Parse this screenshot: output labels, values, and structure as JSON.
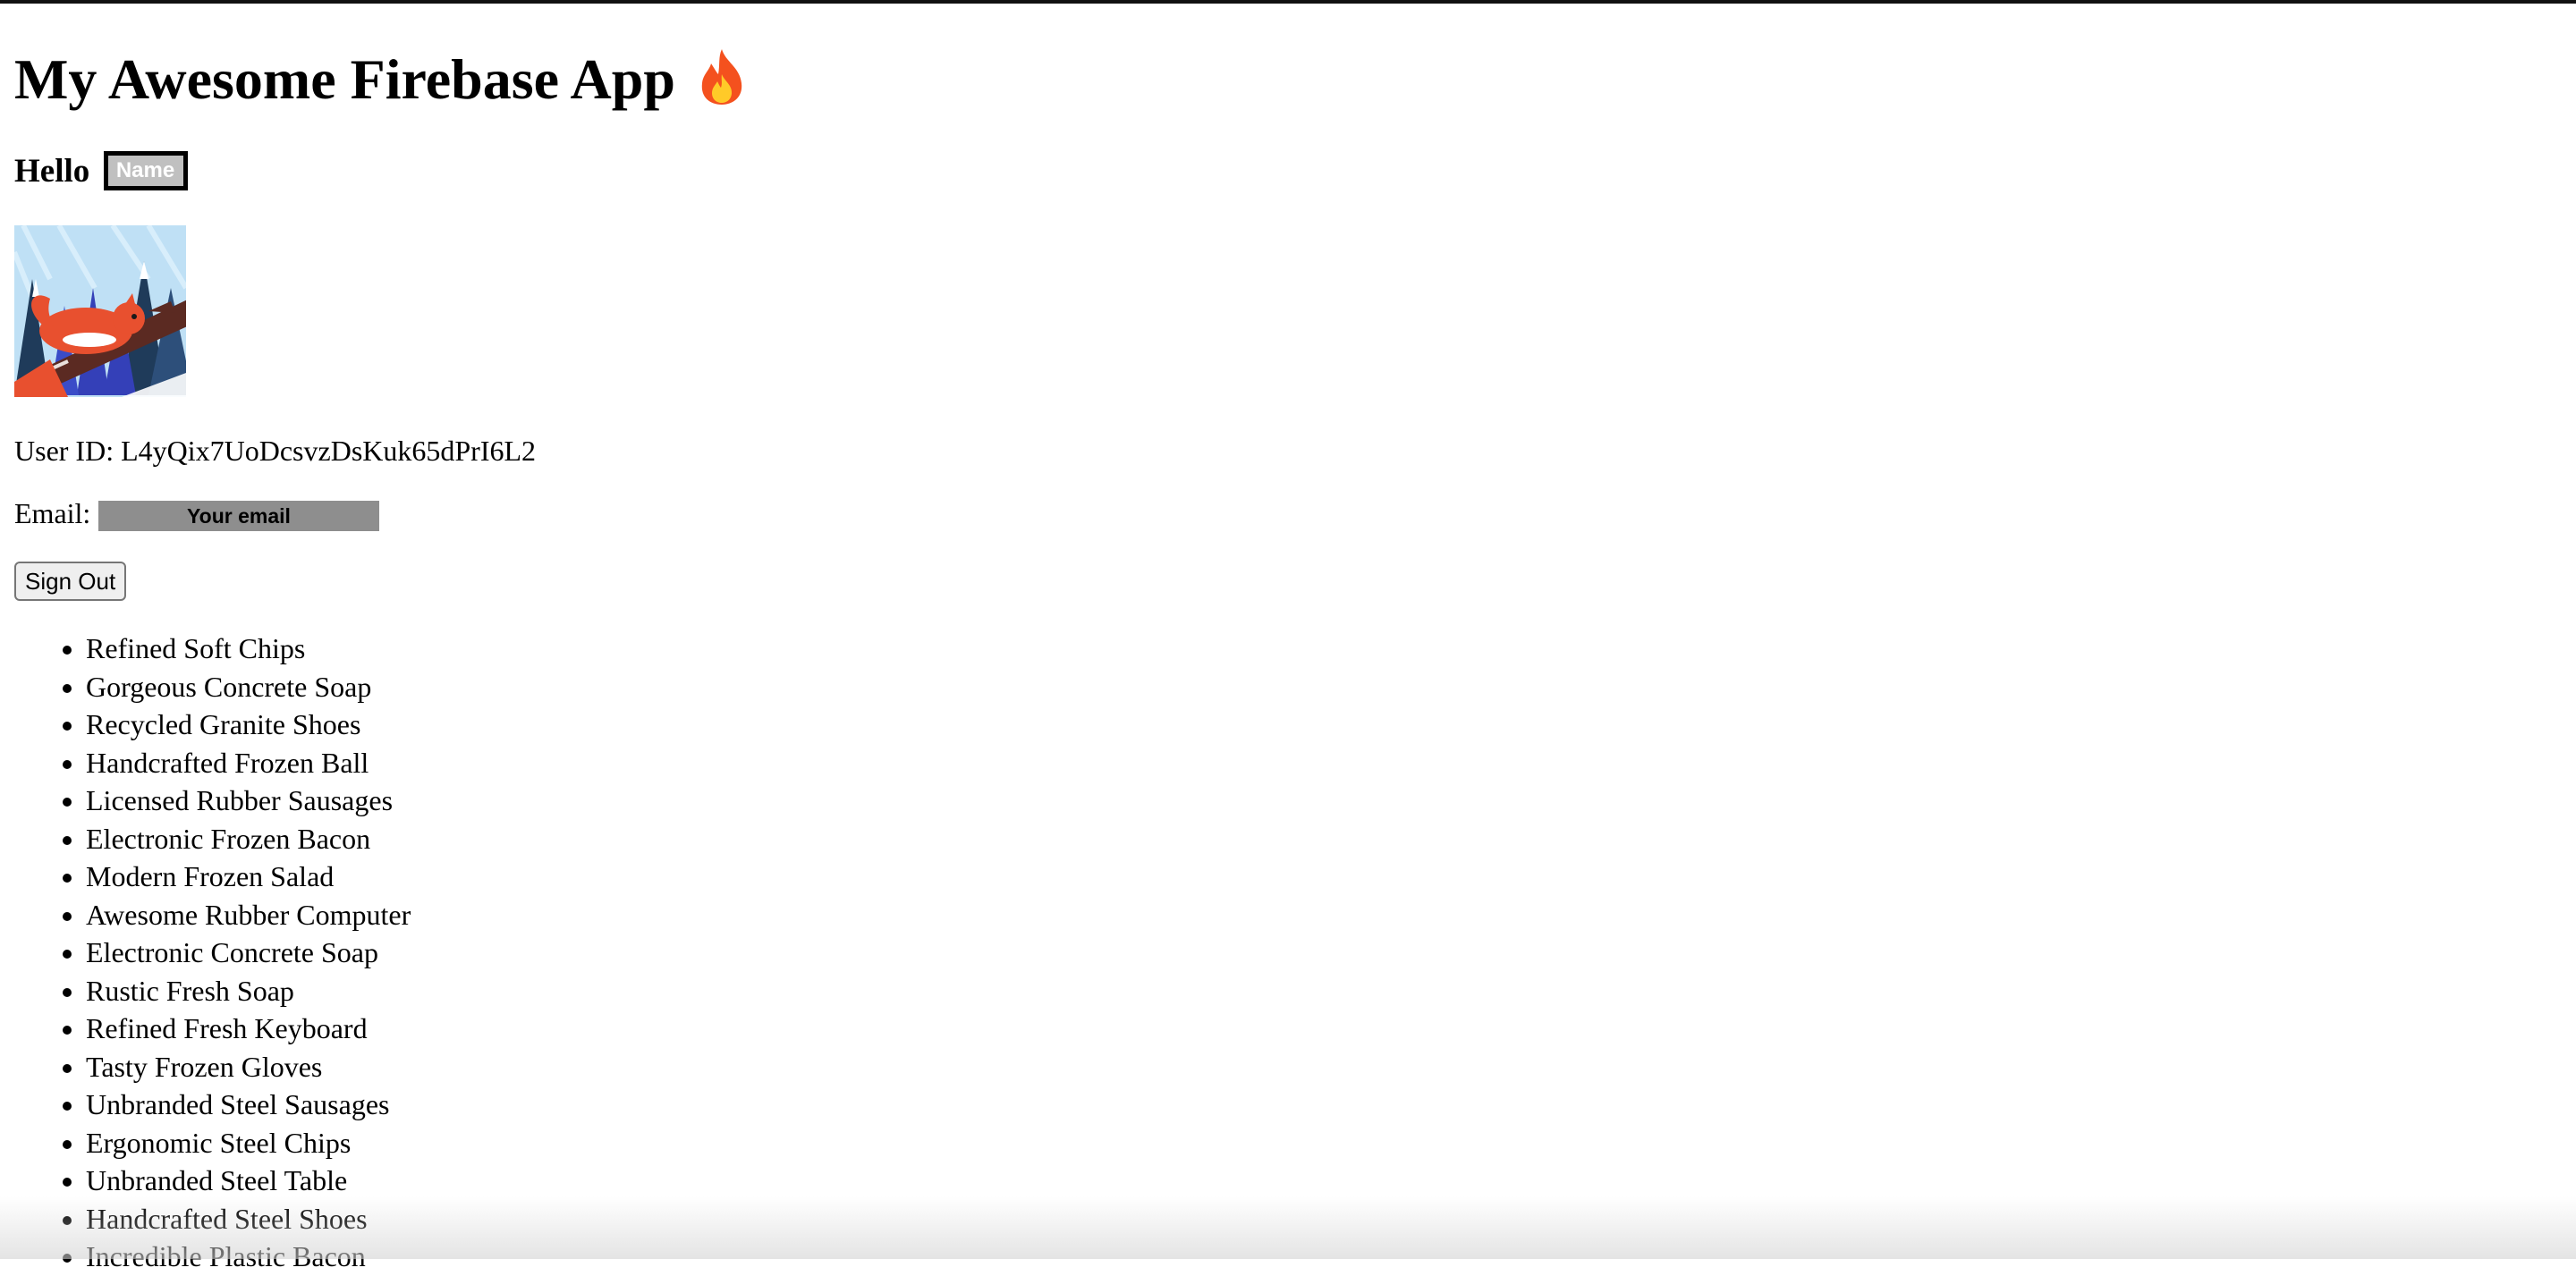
{
  "app": {
    "title": "My Awesome Firebase App",
    "title_icon": "flame-icon"
  },
  "greeting": {
    "hello": "Hello",
    "name_placeholder": "Name"
  },
  "avatar": {
    "icon": "squirrel-avatar-image"
  },
  "user": {
    "id_text": "User ID: L4yQix7UoDcsvzDsKuk65dPrI6L2",
    "email_label": "Email:",
    "email_placeholder": "Your email"
  },
  "actions": {
    "sign_out_label": "Sign Out"
  },
  "products": [
    "Refined Soft Chips",
    "Gorgeous Concrete Soap",
    "Recycled Granite Shoes",
    "Handcrafted Frozen Ball",
    "Licensed Rubber Sausages",
    "Electronic Frozen Bacon",
    "Modern Frozen Salad",
    "Awesome Rubber Computer",
    "Electronic Concrete Soap",
    "Rustic Fresh Soap",
    "Refined Fresh Keyboard",
    "Tasty Frozen Gloves",
    "Unbranded Steel Sausages",
    "Ergonomic Steel Chips",
    "Unbranded Steel Table",
    "Handcrafted Steel Shoes",
    "Incredible Plastic Bacon"
  ],
  "colors": {
    "name_box_bg": "#c0c0c0",
    "email_box_bg": "#8e8e8e",
    "flame_orange": "#f4511e",
    "flame_yellow": "#ffca28"
  }
}
